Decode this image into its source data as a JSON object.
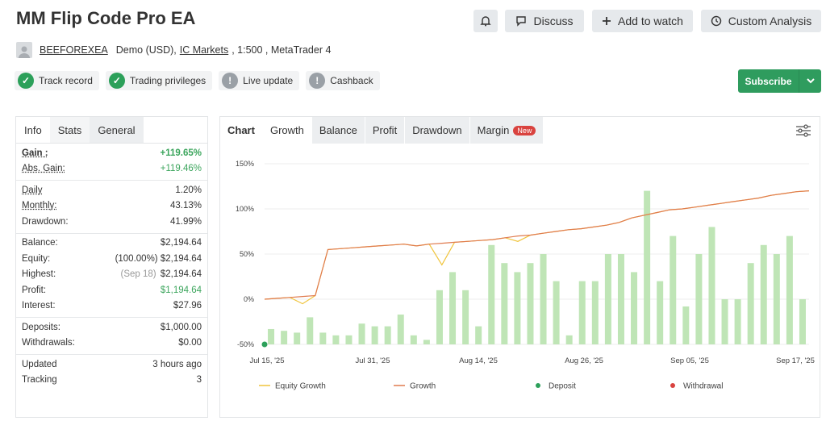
{
  "header": {
    "title": "MM Flip Code Pro EA",
    "discuss": "Discuss",
    "add_to_watch": "Add to watch",
    "custom_analysis": "Custom Analysis"
  },
  "meta": {
    "user": "BEEFOREXEA",
    "account": "Demo (USD),",
    "broker": "IC Markets",
    "details": ", 1:500 , MetaTrader 4"
  },
  "badges": [
    {
      "label": "Track record",
      "status": "ok"
    },
    {
      "label": "Trading privileges",
      "status": "ok"
    },
    {
      "label": "Live update",
      "status": "warn"
    },
    {
      "label": "Cashback",
      "status": "warn"
    }
  ],
  "subscribe": "Subscribe",
  "left_tabs": [
    "Info",
    "Stats",
    "General"
  ],
  "stats": {
    "gain_label": "Gain :",
    "gain": "+119.65%",
    "abs_gain_label": "Abs. Gain:",
    "abs_gain": "+119.46%",
    "daily_label": "Daily",
    "daily": "1.20%",
    "monthly_label": "Monthly:",
    "monthly": "43.13%",
    "drawdown_label": "Drawdown:",
    "drawdown": "41.99%",
    "balance_label": "Balance:",
    "balance": "$2,194.64",
    "equity_label": "Equity:",
    "equity_pct": "(100.00%)",
    "equity": "$2,194.64",
    "highest_label": "Highest:",
    "highest_date": "(Sep 18)",
    "highest": "$2,194.64",
    "profit_label": "Profit:",
    "profit": "$1,194.64",
    "interest_label": "Interest:",
    "interest": "$27.96",
    "deposits_label": "Deposits:",
    "deposits": "$1,000.00",
    "withdrawals_label": "Withdrawals:",
    "withdrawals": "$0.00",
    "updated_label": "Updated",
    "updated": "3 hours ago",
    "tracking_label": "Tracking",
    "tracking": "3"
  },
  "chart_tabs": {
    "chart": "Chart",
    "growth": "Growth",
    "balance": "Balance",
    "profit": "Profit",
    "drawdown": "Drawdown",
    "margin": "Margin",
    "new_badge": "New"
  },
  "chart_data": {
    "type": "line",
    "y_ticks": [
      "150%",
      "100%",
      "50%",
      "0%",
      "-50%"
    ],
    "ylim": [
      -50,
      150
    ],
    "x_ticks": [
      "Jul 15, '25",
      "Jul 31, '25",
      "Aug 14, '25",
      "Aug 26, '25",
      "Sep 05, '25",
      "Sep 17, '25"
    ],
    "legend": [
      "Equity Growth",
      "Growth",
      "Deposit",
      "Withdrawal"
    ],
    "colors": {
      "equity": "#f0c43c",
      "growth": "#e07b4f",
      "bars": "#bfe5b6",
      "deposit": "#2ca05a",
      "withdrawal": "#d9433f"
    },
    "bars": [
      -33,
      -35,
      -37,
      -20,
      -37,
      -40,
      -40,
      -27,
      -30,
      -30,
      -17,
      -40,
      -45,
      10,
      30,
      10,
      -30,
      60,
      40,
      30,
      40,
      50,
      20,
      -40,
      20,
      20,
      50,
      50,
      30,
      120,
      20,
      70,
      -8,
      50,
      80,
      0,
      0,
      40,
      60,
      50,
      70,
      0
    ],
    "growth": [
      0,
      1,
      2,
      3,
      4,
      55,
      56,
      57,
      58,
      59,
      60,
      61,
      59,
      61,
      62,
      63,
      64,
      65,
      66,
      68,
      70,
      71,
      73,
      75,
      77,
      78,
      80,
      82,
      85,
      90,
      93,
      96,
      99,
      100,
      102,
      104,
      106,
      108,
      110,
      112,
      115,
      117,
      119,
      120
    ],
    "equity": [
      0,
      1,
      2,
      -5,
      4,
      55,
      56,
      57,
      58,
      59,
      60,
      61,
      59,
      61,
      38,
      63,
      64,
      65,
      66,
      68,
      64,
      71,
      73,
      75,
      77,
      78,
      80,
      82,
      85,
      90,
      93,
      96,
      99,
      100,
      102,
      104,
      106,
      108,
      110,
      112,
      115,
      117,
      119,
      120
    ],
    "deposit": {
      "x_index": 0,
      "value": -50
    }
  }
}
